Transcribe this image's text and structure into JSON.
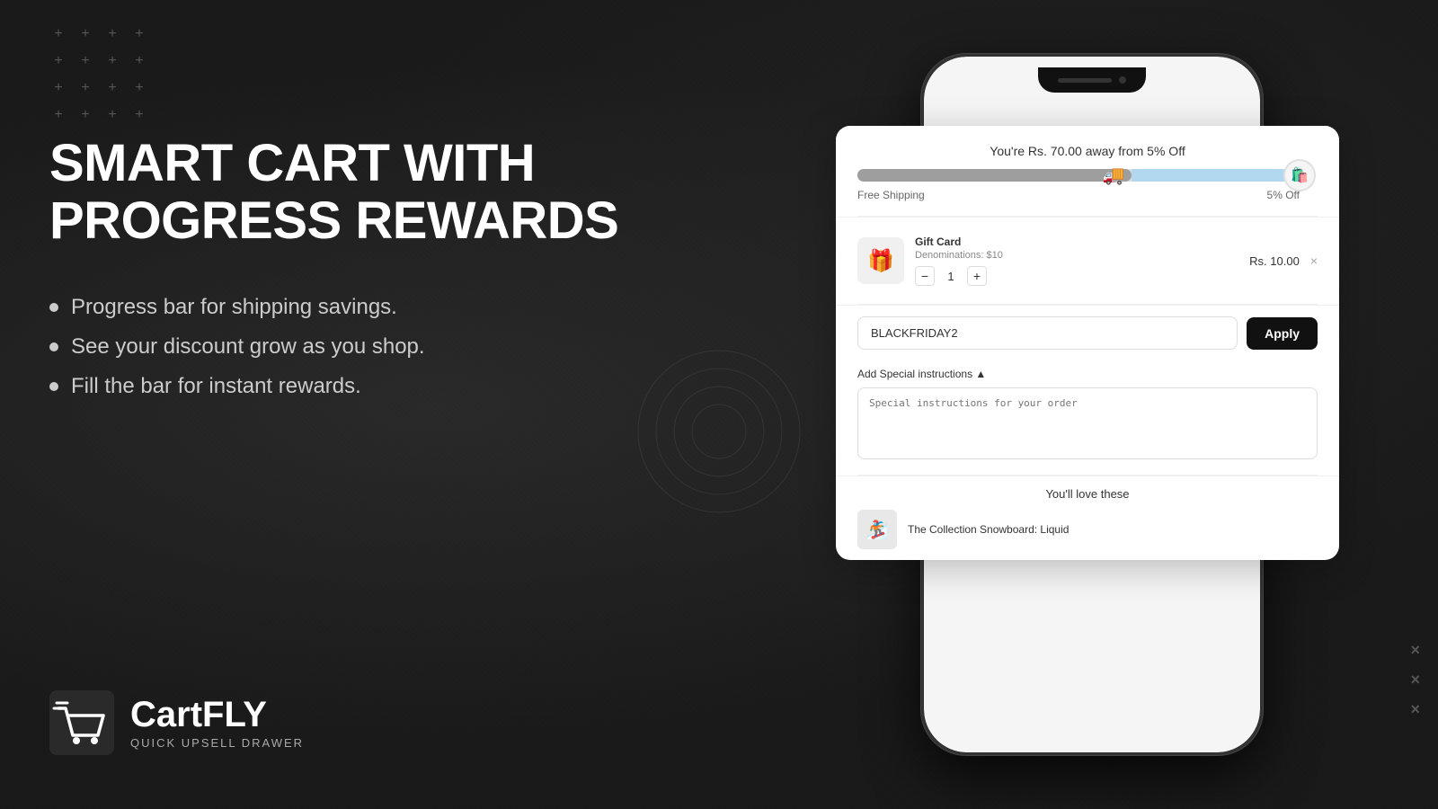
{
  "background": {
    "color": "#1a1a1a"
  },
  "plus_grid": {
    "symbol": "+"
  },
  "left_panel": {
    "title_line1": "SMART CART WITH",
    "title_line2": "PROGRESS REWARDS",
    "bullets": [
      "Progress bar for shipping savings.",
      "See your discount grow as you shop.",
      "Fill the bar for instant rewards."
    ]
  },
  "logo": {
    "name": "CartFLY",
    "subtitle": "QUICK UPSELL DRAWER"
  },
  "cart": {
    "progress_title": "You're Rs. 70.00 away from 5% Off",
    "progress_fill_percent": 62,
    "progress_label_left": "Free Shipping",
    "progress_label_right": "5% Off",
    "item": {
      "name": "Gift Card",
      "denomination": "Denominations: $10",
      "quantity": 1,
      "price": "Rs. 10.00"
    },
    "discount_code": "BLACKFRIDAY2",
    "apply_label": "Apply",
    "instructions_toggle": "Add Special instructions ▲",
    "instructions_placeholder": "Special instructions for your order",
    "upsell_title": "You'll love these",
    "upsell_item": "The Collection Snowboard: Liquid"
  },
  "x_marks": [
    "×",
    "×",
    "×"
  ]
}
